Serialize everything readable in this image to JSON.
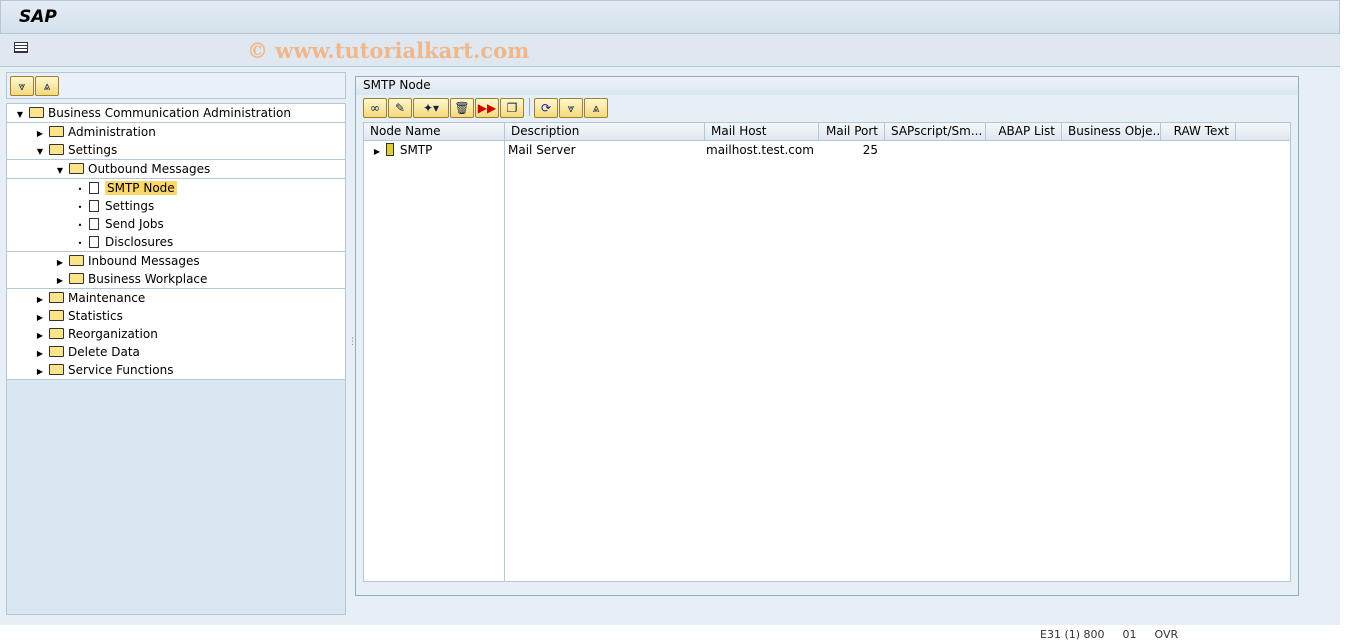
{
  "app": {
    "logo": "SAP",
    "watermark": "© www.tutorialkart.com"
  },
  "tree": {
    "root": "Business Communication Administration",
    "items": [
      "Administration",
      "Settings",
      "Outbound Messages",
      "SMTP Node",
      "Settings",
      "Send Jobs",
      "Disclosures",
      "Inbound Messages",
      "Business Workplace",
      "Maintenance",
      "Statistics",
      "Reorganization",
      "Delete Data",
      "Service Functions"
    ]
  },
  "panel": {
    "title": "SMTP Node"
  },
  "grid": {
    "columns": [
      "Node Name",
      "Description",
      "Mail Host",
      "Mail Port",
      "SAPscript/Sm...",
      "ABAP List",
      "Business Obje...",
      "RAW Text"
    ],
    "rows": [
      {
        "node": "SMTP",
        "description": "Mail Server",
        "host": "mailhost.test.com",
        "port": "25"
      }
    ]
  },
  "status": {
    "system": "E31 (1) 800",
    "session": "01",
    "mode": "OVR"
  }
}
